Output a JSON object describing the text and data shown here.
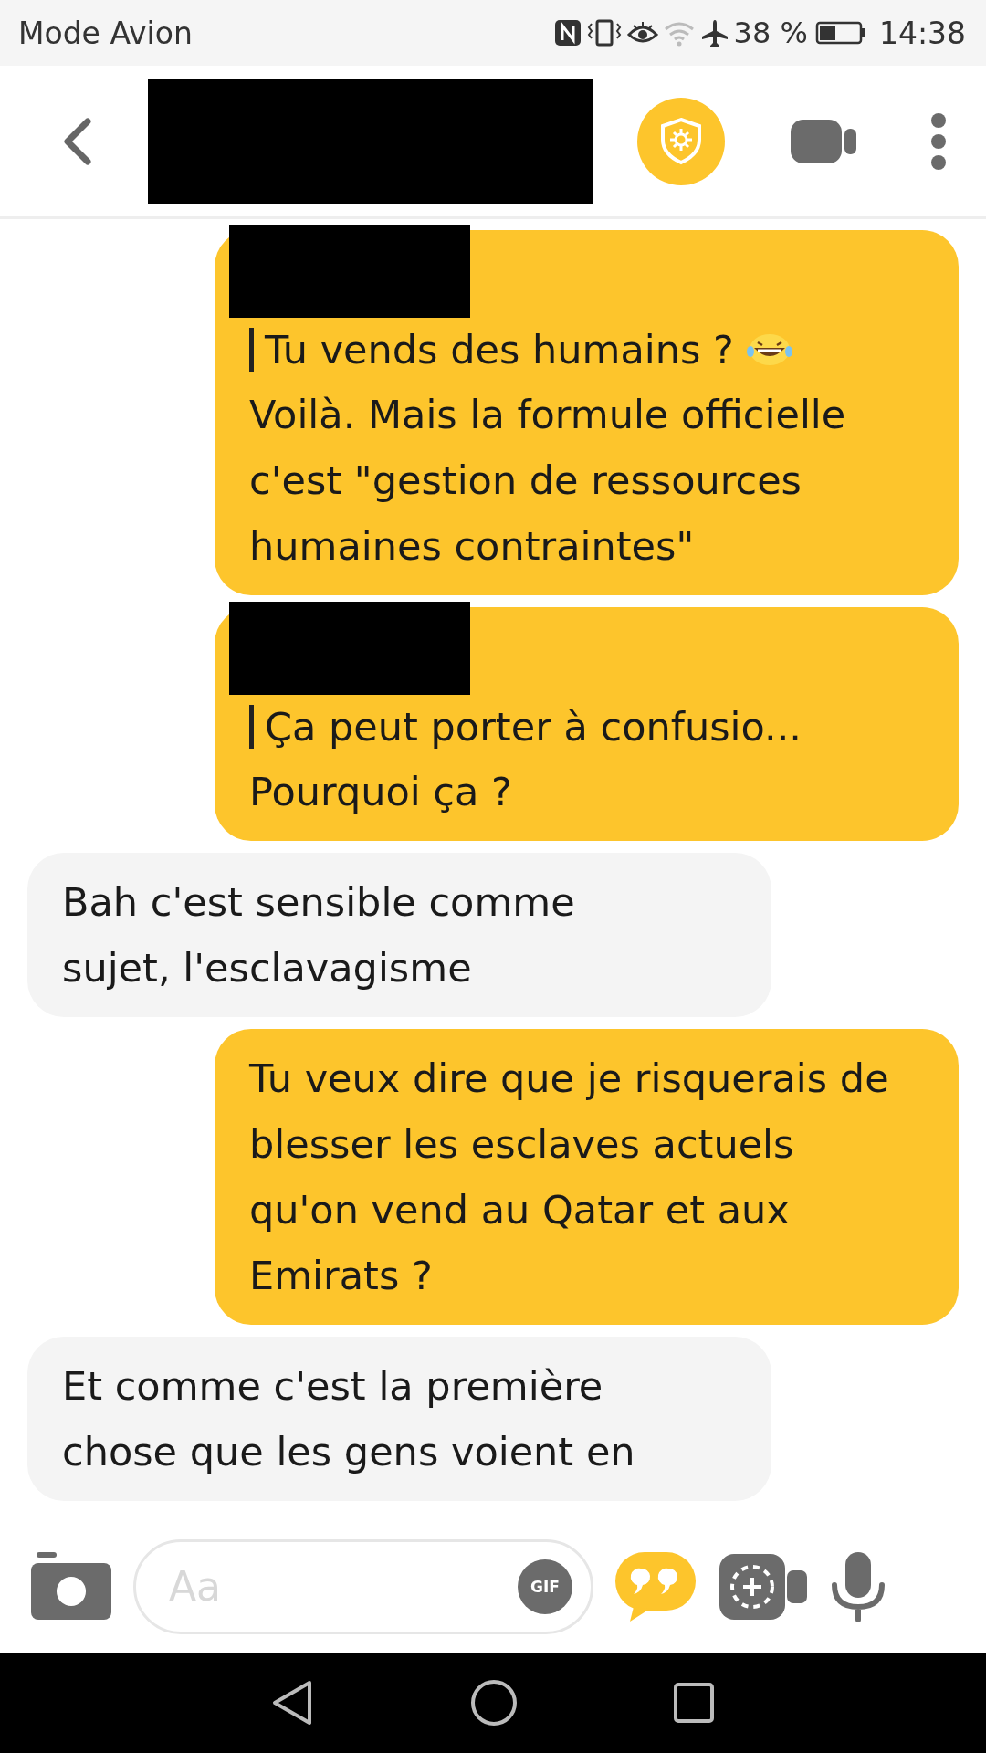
{
  "status_bar": {
    "carrier": "Mode Avion",
    "battery": "38 %",
    "time": "14:38"
  },
  "header": {
    "name_redacted": true
  },
  "messages": [
    {
      "kind": "sent",
      "redacted": true,
      "quote": "Tu vends des humains ?",
      "quote_emoji": true,
      "text": "Voilà. Mais la formule officielle c'est \"gestion de ressources humaines contraintes\""
    },
    {
      "kind": "sent",
      "redacted": true,
      "quote": "Ça peut porter à confusio...",
      "text": "Pourquoi ça ?"
    },
    {
      "kind": "received",
      "text": "Bah c'est sensible comme sujet, l'esclavagisme"
    },
    {
      "kind": "sent",
      "text": "Tu veux dire que je risquerais de blesser les esclaves actuels qu'on vend au Qatar et aux Emirats ?"
    },
    {
      "kind": "received",
      "text": "Et comme c'est la première chose que les gens voient en"
    }
  ],
  "composer": {
    "placeholder": "Aa",
    "gif_label": "GIF"
  }
}
